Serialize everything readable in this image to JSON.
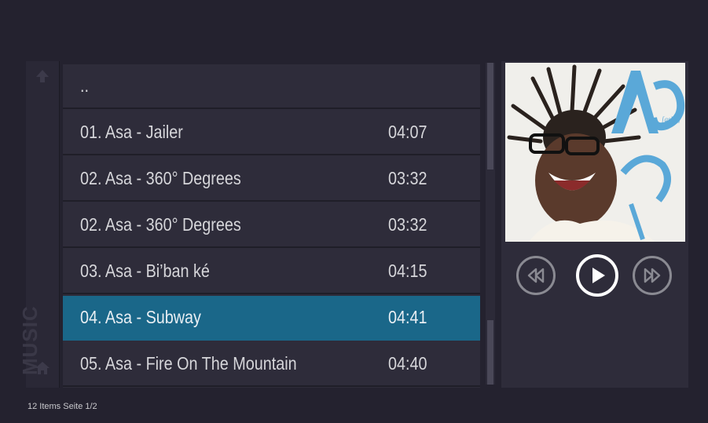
{
  "sidebar": {
    "label": "MUSIC",
    "up_icon": "arrow-up-icon",
    "home_icon": "home-icon"
  },
  "list": {
    "items": [
      {
        "title": "..",
        "duration": ""
      },
      {
        "title": "01. Asa - Jailer",
        "duration": "04:07"
      },
      {
        "title": "02. Asa - 360° Degrees",
        "duration": "03:32"
      },
      {
        "title": "02. Asa - 360° Degrees",
        "duration": "03:32"
      },
      {
        "title": "03. Asa - Bi’ban ké",
        "duration": "04:15"
      },
      {
        "title": "04. Asa - Subway",
        "duration": "04:41",
        "selected": true
      },
      {
        "title": "05. Asa - Fire On The Mountain",
        "duration": "04:40"
      }
    ]
  },
  "player": {
    "album_text": "Aṣa",
    "album_subtext": "[asha]",
    "prev_icon": "rewind-icon",
    "play_icon": "play-icon",
    "next_icon": "fast-forward-icon"
  },
  "status": {
    "text": "12 Items Seite 1/2"
  },
  "colors": {
    "background": "#24222f",
    "panel": "#2e2c3a",
    "selected": "#1a6789"
  }
}
